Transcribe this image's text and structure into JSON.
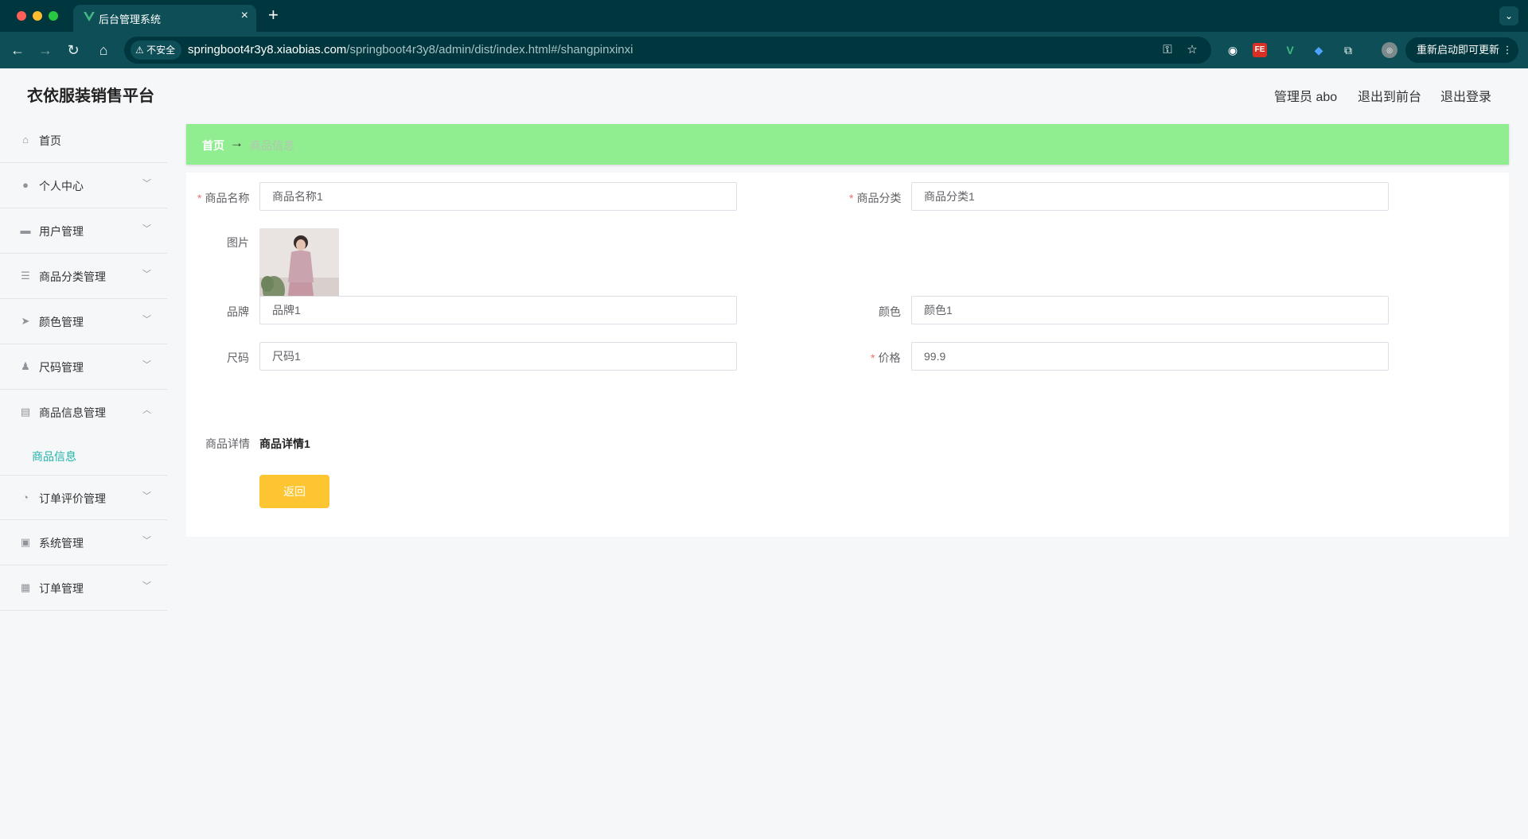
{
  "browser": {
    "tab_title": "后台管理系统",
    "tab_close": "×",
    "new_tab": "+",
    "insecure_label": "不安全",
    "url_host": "springboot4r3y8.xiaobias.com",
    "url_path": "/springboot4r3y8/admin/dist/index.html#/shangpinxinxi",
    "update_label": "重新启动即可更新",
    "update_menu": "⋮"
  },
  "app": {
    "title": "衣依服装销售平台",
    "user_label": "管理员 abo",
    "front_link": "退出到前台",
    "logout_link": "退出登录"
  },
  "sidebar": {
    "items": [
      {
        "label": "首页",
        "icon": "home-icon"
      },
      {
        "label": "个人中心",
        "icon": "user-icon"
      },
      {
        "label": "用户管理",
        "icon": "users-icon"
      },
      {
        "label": "商品分类管理",
        "icon": "list-icon"
      },
      {
        "label": "颜色管理",
        "icon": "send-icon"
      },
      {
        "label": "尺码管理",
        "icon": "person-icon"
      },
      {
        "label": "商品信息管理",
        "icon": "message-icon"
      },
      {
        "label": "订单评价管理",
        "icon": "gauge-icon"
      },
      {
        "label": "系统管理",
        "icon": "clipboard-icon"
      },
      {
        "label": "订单管理",
        "icon": "grid-icon"
      }
    ],
    "subitem": "商品信息"
  },
  "breadcrumb": {
    "home": "首页",
    "separator": "→",
    "current": "商品信息"
  },
  "form": {
    "name_label": "商品名称",
    "name_value": "商品名称1",
    "category_label": "商品分类",
    "category_value": "商品分类1",
    "image_label": "图片",
    "brand_label": "品牌",
    "brand_value": "品牌1",
    "color_label": "颜色",
    "color_value": "颜色1",
    "size_label": "尺码",
    "size_value": "尺码1",
    "price_label": "价格",
    "price_value": "99.9",
    "detail_label": "商品详情",
    "detail_value": "商品详情1",
    "back_button": "返回",
    "required_mark": "*"
  },
  "colors": {
    "accent": "#20b2aa",
    "breadcrumb_bg": "#90ee90",
    "button_bg": "#fdc531",
    "required": "#f56c6c"
  }
}
